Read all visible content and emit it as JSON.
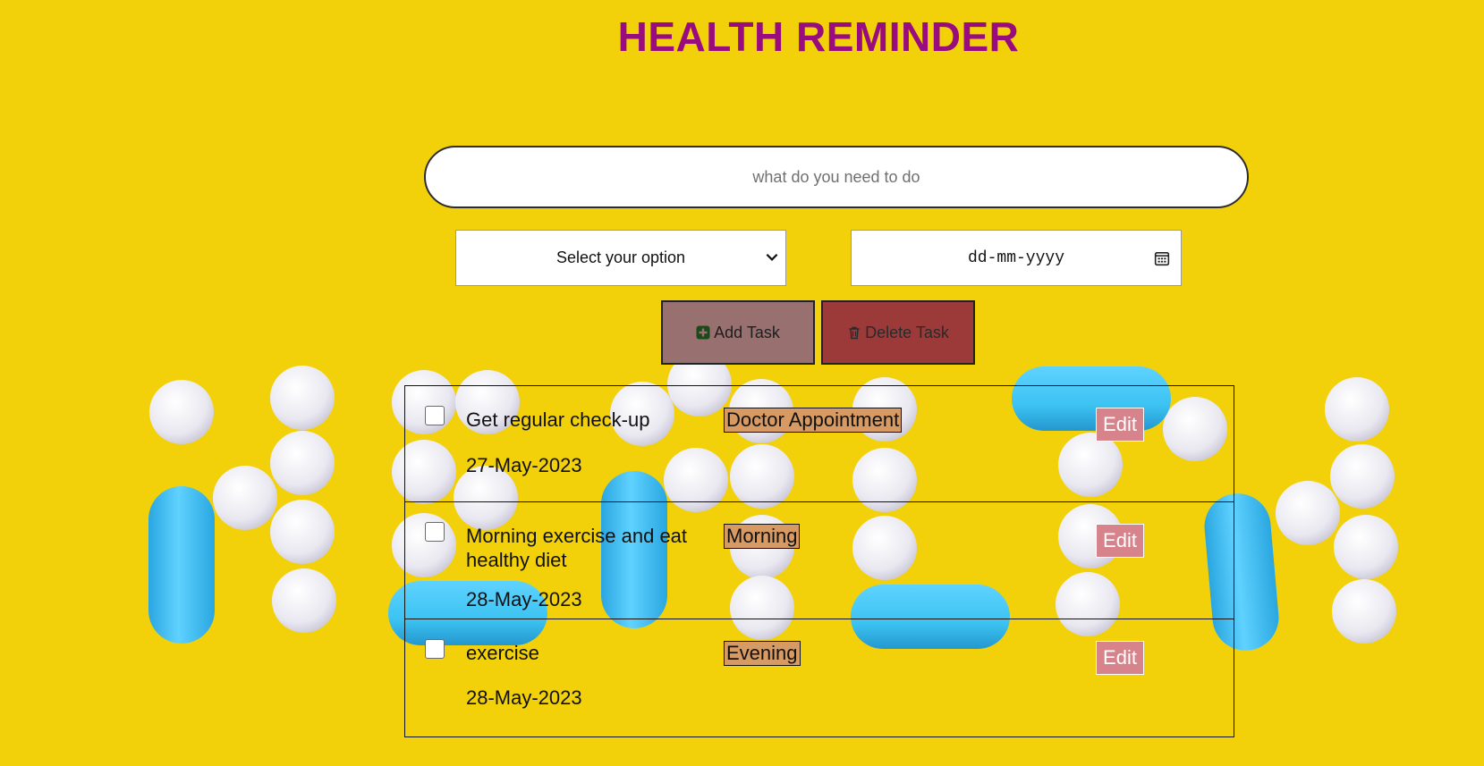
{
  "title": "HEALTH REMINDER",
  "input": {
    "placeholder": "what do you need to do",
    "value": ""
  },
  "category_select": {
    "selected": "Select your option"
  },
  "date_input": {
    "placeholder": "dd-mm-yyyy"
  },
  "buttons": {
    "add_label": "Add Task",
    "delete_label": "Delete Task"
  },
  "tasks": [
    {
      "text": "Get regular check-up",
      "category": "Doctor Appointment",
      "date": "27-May-2023",
      "checked": false,
      "edit_label": "Edit"
    },
    {
      "text": "Morning exercise and eat healthy diet",
      "category": "Morning",
      "date": "28-May-2023",
      "checked": false,
      "edit_label": "Edit"
    },
    {
      "text": "exercise",
      "category": "Evening",
      "date": "28-May-2023",
      "checked": false,
      "edit_label": "Edit"
    }
  ],
  "icons": {
    "add": "plus-square-icon",
    "delete": "trash-icon",
    "select": "chevron-down-icon",
    "date": "calendar-icon"
  },
  "colors": {
    "background": "#f2d10a",
    "title": "#980c7d",
    "add_button": "#987070",
    "delete_button": "#9c3a3a",
    "category_badge": "#d79a63",
    "edit_button": "#d6838b",
    "pill_white": "#ecebf2",
    "pill_blue": "#3cc3f2"
  }
}
